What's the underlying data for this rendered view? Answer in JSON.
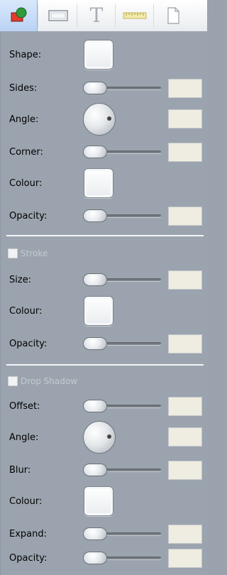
{
  "tabs": [
    {
      "name": "shape-tab",
      "icon": "shape-icon",
      "active": true
    },
    {
      "name": "textbox-tab",
      "icon": "rectangle-icon",
      "active": false
    },
    {
      "name": "text-tab",
      "icon": "text-icon",
      "active": false
    },
    {
      "name": "ruler-tab",
      "icon": "ruler-icon",
      "active": false
    },
    {
      "name": "page-tab",
      "icon": "page-icon",
      "active": false
    }
  ],
  "fill": {
    "shape_label": "Shape:",
    "sides_label": "Sides:",
    "angle_label": "Angle:",
    "corner_label": "Corner:",
    "colour_label": "Colour:",
    "opacity_label": "Opacity:"
  },
  "stroke": {
    "checkbox_label": "Stroke",
    "checked": false,
    "size_label": "Size:",
    "colour_label": "Colour:",
    "opacity_label": "Opacity:"
  },
  "shadow": {
    "checkbox_label": "Drop Shadow",
    "checked": false,
    "offset_label": "Offset:",
    "angle_label": "Angle:",
    "blur_label": "Blur:",
    "colour_label": "Colour:",
    "expand_label": "Expand:",
    "opacity_label": "Opacity:"
  },
  "colors": {
    "panel_bg": "#9ba4ae",
    "value_box_bg": "#efece1",
    "divider": "#f4f6f8",
    "tab_active_bg": "#c5dbf7"
  }
}
